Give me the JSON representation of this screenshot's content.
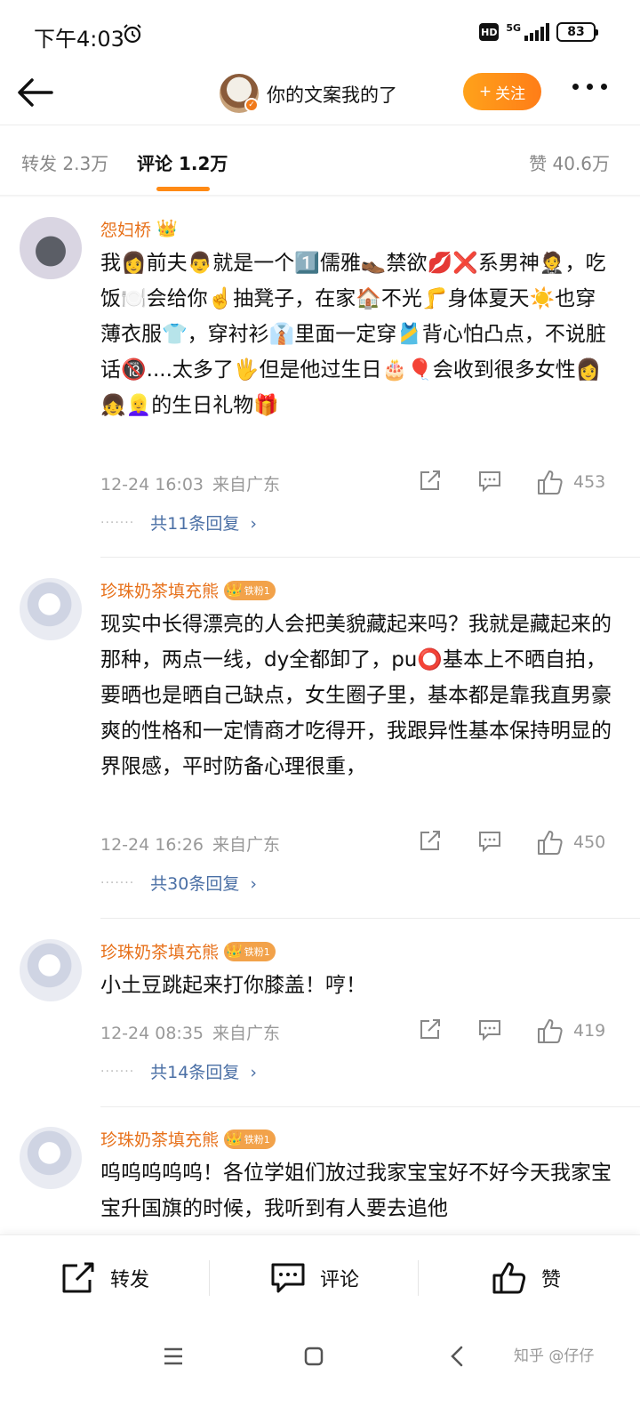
{
  "status_bar": {
    "time": "下午4:03",
    "hd": "HD",
    "network": "5G",
    "battery": "83"
  },
  "header": {
    "author_name": "你的文案我的了",
    "follow_label": "关注",
    "follow_plus": "+"
  },
  "tabs": {
    "repost": "转发 2.3万",
    "comment": "评论 1.2万",
    "like": "赞 40.6万"
  },
  "comments": [
    {
      "username": "怨妇桥",
      "text": "我👩前夫👨就是一个1️⃣儒雅👞禁欲💋❌系男神🤵，吃饭🍽️会给你☝️抽凳子，在家🏠不光🦵身体夏天☀️也穿薄衣服👕，穿衬衫👔里面一定穿🎽背心怕凸点，不说脏话🔞....太多了🖐️但是他过生日🎂🎈会收到很多女性👩👧👱‍♀️的生日礼物🎁",
      "time": "12-24 16:03",
      "source": "来自广东",
      "likes": "453",
      "replies": "共11条回复"
    },
    {
      "username": "珍珠奶茶填充熊",
      "fan_badge": "铁粉1",
      "text": "现实中长得漂亮的人会把美貌藏起来吗？我就是藏起来的那种，两点一线，dy全都卸了，pu⭕基本上不晒自拍，要晒也是晒自己缺点，女生圈子里，基本都是靠我直男豪爽的性格和一定情商才吃得开，我跟异性基本保持明显的界限感，平时防备心理很重，",
      "time": "12-24 16:26",
      "source": "来自广东",
      "likes": "450",
      "replies": "共30条回复"
    },
    {
      "username": "珍珠奶茶填充熊",
      "fan_badge": "铁粉1",
      "text": "小土豆跳起来打你膝盖！哼！",
      "time": "12-24 08:35",
      "source": "来自广东",
      "likes": "419",
      "replies": "共14条回复"
    },
    {
      "username": "珍珠奶茶填充熊",
      "fan_badge": "铁粉1",
      "text": "呜呜呜呜呜！各位学姐们放过我家宝宝好不好今天我家宝宝升国旗的时候，我听到有人要去追他"
    }
  ],
  "bottom_bar": {
    "repost": "转发",
    "comment": "评论",
    "like": "赞"
  },
  "watermark": "知乎 @仔仔",
  "colors": {
    "accent": "#ff8a14",
    "username": "#e7711b",
    "reply_link": "#4a6fa5",
    "meta": "#999999"
  }
}
